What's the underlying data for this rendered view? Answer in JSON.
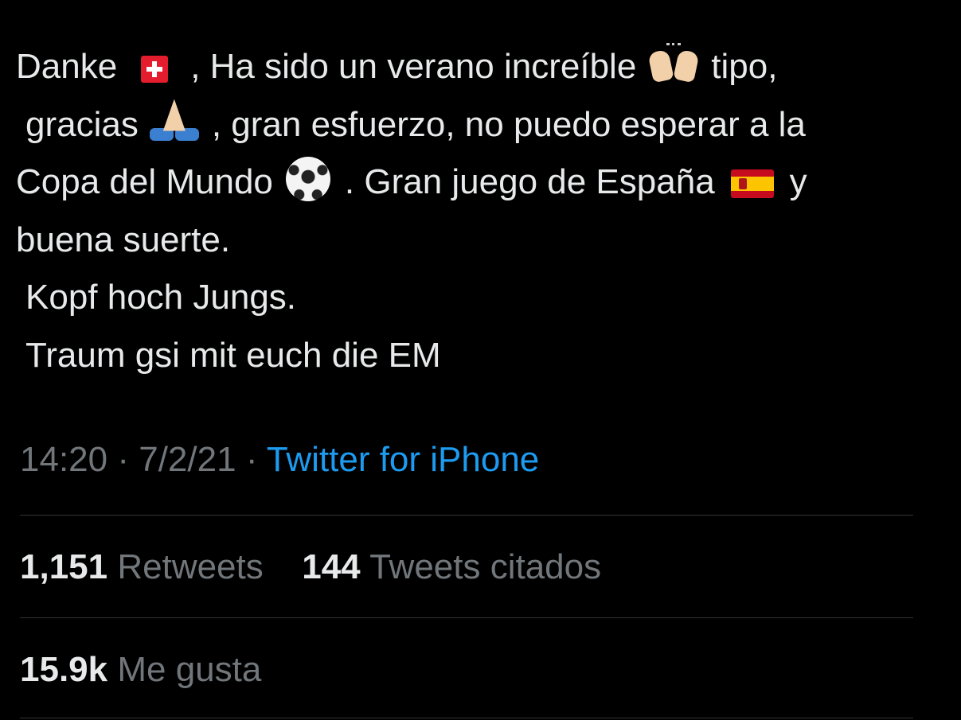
{
  "tweet": {
    "lines": [
      [
        "Danke",
        ", Ha sido un verano increíble",
        "tipo,"
      ],
      [
        "gracias",
        ", gran esfuerzo, no puedo esperar a la"
      ],
      [
        "Copa del Mundo",
        ". Gran juego de España",
        "y"
      ],
      [
        "buena suerte."
      ],
      [
        "Kopf hoch Jungs."
      ],
      [
        "Traum gsi mit euch die EM"
      ]
    ],
    "emojis": [
      "swiss-flag",
      "raised-hands",
      "folded-hands",
      "soccer-ball",
      "spain-flag"
    ]
  },
  "meta": {
    "time": "14:20",
    "date": "7/2/21",
    "separator": "·",
    "source": "Twitter for iPhone"
  },
  "stats": {
    "retweets_count": "1,151",
    "retweets_label": "Retweets",
    "quotes_count": "144",
    "quotes_label": "Tweets citados",
    "likes_count": "15.9k",
    "likes_label": "Me gusta"
  },
  "colors": {
    "background": "#000000",
    "text": "#e7e9ea",
    "muted": "#71767b",
    "link": "#1d9bf0",
    "divider": "#2f3336"
  }
}
